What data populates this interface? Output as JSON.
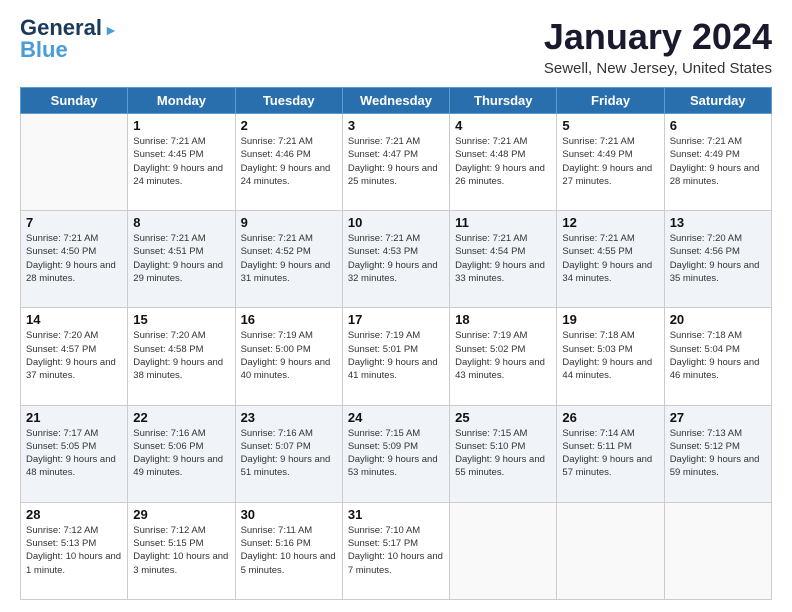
{
  "logo": {
    "line1": "General",
    "line2": "Blue",
    "accent": "Blue"
  },
  "header": {
    "month": "January 2024",
    "location": "Sewell, New Jersey, United States"
  },
  "weekdays": [
    "Sunday",
    "Monday",
    "Tuesday",
    "Wednesday",
    "Thursday",
    "Friday",
    "Saturday"
  ],
  "weeks": [
    [
      {
        "day": "",
        "sunrise": "",
        "sunset": "",
        "daylight": "",
        "empty": true
      },
      {
        "day": "1",
        "sunrise": "Sunrise: 7:21 AM",
        "sunset": "Sunset: 4:45 PM",
        "daylight": "Daylight: 9 hours and 24 minutes."
      },
      {
        "day": "2",
        "sunrise": "Sunrise: 7:21 AM",
        "sunset": "Sunset: 4:46 PM",
        "daylight": "Daylight: 9 hours and 24 minutes."
      },
      {
        "day": "3",
        "sunrise": "Sunrise: 7:21 AM",
        "sunset": "Sunset: 4:47 PM",
        "daylight": "Daylight: 9 hours and 25 minutes."
      },
      {
        "day": "4",
        "sunrise": "Sunrise: 7:21 AM",
        "sunset": "Sunset: 4:48 PM",
        "daylight": "Daylight: 9 hours and 26 minutes."
      },
      {
        "day": "5",
        "sunrise": "Sunrise: 7:21 AM",
        "sunset": "Sunset: 4:49 PM",
        "daylight": "Daylight: 9 hours and 27 minutes."
      },
      {
        "day": "6",
        "sunrise": "Sunrise: 7:21 AM",
        "sunset": "Sunset: 4:49 PM",
        "daylight": "Daylight: 9 hours and 28 minutes."
      }
    ],
    [
      {
        "day": "7",
        "sunrise": "Sunrise: 7:21 AM",
        "sunset": "Sunset: 4:50 PM",
        "daylight": "Daylight: 9 hours and 28 minutes."
      },
      {
        "day": "8",
        "sunrise": "Sunrise: 7:21 AM",
        "sunset": "Sunset: 4:51 PM",
        "daylight": "Daylight: 9 hours and 29 minutes."
      },
      {
        "day": "9",
        "sunrise": "Sunrise: 7:21 AM",
        "sunset": "Sunset: 4:52 PM",
        "daylight": "Daylight: 9 hours and 31 minutes."
      },
      {
        "day": "10",
        "sunrise": "Sunrise: 7:21 AM",
        "sunset": "Sunset: 4:53 PM",
        "daylight": "Daylight: 9 hours and 32 minutes."
      },
      {
        "day": "11",
        "sunrise": "Sunrise: 7:21 AM",
        "sunset": "Sunset: 4:54 PM",
        "daylight": "Daylight: 9 hours and 33 minutes."
      },
      {
        "day": "12",
        "sunrise": "Sunrise: 7:21 AM",
        "sunset": "Sunset: 4:55 PM",
        "daylight": "Daylight: 9 hours and 34 minutes."
      },
      {
        "day": "13",
        "sunrise": "Sunrise: 7:20 AM",
        "sunset": "Sunset: 4:56 PM",
        "daylight": "Daylight: 9 hours and 35 minutes."
      }
    ],
    [
      {
        "day": "14",
        "sunrise": "Sunrise: 7:20 AM",
        "sunset": "Sunset: 4:57 PM",
        "daylight": "Daylight: 9 hours and 37 minutes."
      },
      {
        "day": "15",
        "sunrise": "Sunrise: 7:20 AM",
        "sunset": "Sunset: 4:58 PM",
        "daylight": "Daylight: 9 hours and 38 minutes."
      },
      {
        "day": "16",
        "sunrise": "Sunrise: 7:19 AM",
        "sunset": "Sunset: 5:00 PM",
        "daylight": "Daylight: 9 hours and 40 minutes."
      },
      {
        "day": "17",
        "sunrise": "Sunrise: 7:19 AM",
        "sunset": "Sunset: 5:01 PM",
        "daylight": "Daylight: 9 hours and 41 minutes."
      },
      {
        "day": "18",
        "sunrise": "Sunrise: 7:19 AM",
        "sunset": "Sunset: 5:02 PM",
        "daylight": "Daylight: 9 hours and 43 minutes."
      },
      {
        "day": "19",
        "sunrise": "Sunrise: 7:18 AM",
        "sunset": "Sunset: 5:03 PM",
        "daylight": "Daylight: 9 hours and 44 minutes."
      },
      {
        "day": "20",
        "sunrise": "Sunrise: 7:18 AM",
        "sunset": "Sunset: 5:04 PM",
        "daylight": "Daylight: 9 hours and 46 minutes."
      }
    ],
    [
      {
        "day": "21",
        "sunrise": "Sunrise: 7:17 AM",
        "sunset": "Sunset: 5:05 PM",
        "daylight": "Daylight: 9 hours and 48 minutes."
      },
      {
        "day": "22",
        "sunrise": "Sunrise: 7:16 AM",
        "sunset": "Sunset: 5:06 PM",
        "daylight": "Daylight: 9 hours and 49 minutes."
      },
      {
        "day": "23",
        "sunrise": "Sunrise: 7:16 AM",
        "sunset": "Sunset: 5:07 PM",
        "daylight": "Daylight: 9 hours and 51 minutes."
      },
      {
        "day": "24",
        "sunrise": "Sunrise: 7:15 AM",
        "sunset": "Sunset: 5:09 PM",
        "daylight": "Daylight: 9 hours and 53 minutes."
      },
      {
        "day": "25",
        "sunrise": "Sunrise: 7:15 AM",
        "sunset": "Sunset: 5:10 PM",
        "daylight": "Daylight: 9 hours and 55 minutes."
      },
      {
        "day": "26",
        "sunrise": "Sunrise: 7:14 AM",
        "sunset": "Sunset: 5:11 PM",
        "daylight": "Daylight: 9 hours and 57 minutes."
      },
      {
        "day": "27",
        "sunrise": "Sunrise: 7:13 AM",
        "sunset": "Sunset: 5:12 PM",
        "daylight": "Daylight: 9 hours and 59 minutes."
      }
    ],
    [
      {
        "day": "28",
        "sunrise": "Sunrise: 7:12 AM",
        "sunset": "Sunset: 5:13 PM",
        "daylight": "Daylight: 10 hours and 1 minute."
      },
      {
        "day": "29",
        "sunrise": "Sunrise: 7:12 AM",
        "sunset": "Sunset: 5:15 PM",
        "daylight": "Daylight: 10 hours and 3 minutes."
      },
      {
        "day": "30",
        "sunrise": "Sunrise: 7:11 AM",
        "sunset": "Sunset: 5:16 PM",
        "daylight": "Daylight: 10 hours and 5 minutes."
      },
      {
        "day": "31",
        "sunrise": "Sunrise: 7:10 AM",
        "sunset": "Sunset: 5:17 PM",
        "daylight": "Daylight: 10 hours and 7 minutes."
      },
      {
        "day": "",
        "sunrise": "",
        "sunset": "",
        "daylight": "",
        "empty": true
      },
      {
        "day": "",
        "sunrise": "",
        "sunset": "",
        "daylight": "",
        "empty": true
      },
      {
        "day": "",
        "sunrise": "",
        "sunset": "",
        "daylight": "",
        "empty": true
      }
    ]
  ],
  "colors": {
    "header_bg": "#2a6fad",
    "header_text": "#ffffff",
    "shaded_row": "#f0f4f8",
    "title_color": "#1a1a2e",
    "logo_blue": "#1a3a5c",
    "logo_accent": "#4a9cd6"
  }
}
